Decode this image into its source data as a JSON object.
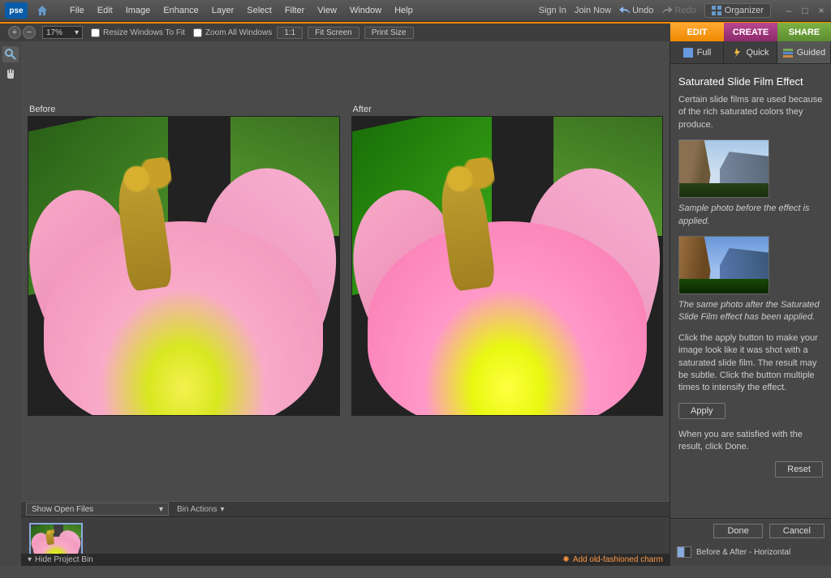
{
  "app_logo": "pse",
  "menu": [
    "File",
    "Edit",
    "Image",
    "Enhance",
    "Layer",
    "Select",
    "Filter",
    "View",
    "Window",
    "Help"
  ],
  "topbar": {
    "signin": "Sign In",
    "joinnow": "Join Now",
    "undo": "Undo",
    "redo": "Redo",
    "organizer": "Organizer"
  },
  "options": {
    "zoom_percent": "17%",
    "resize_windows": "Resize Windows To Fit",
    "zoom_all": "Zoom All Windows",
    "one_to_one": "1:1",
    "fit_screen": "Fit Screen",
    "print_size": "Print Size"
  },
  "mode_tabs": {
    "edit": "EDIT",
    "create": "CREATE",
    "share": "SHARE"
  },
  "compare": {
    "before_label": "Before",
    "after_label": "After"
  },
  "bin": {
    "dropdown": "Show Open Files",
    "actions": "Bin Actions"
  },
  "subtabs": {
    "full": "Full",
    "quick": "Quick",
    "guided": "Guided"
  },
  "panel": {
    "title": "Saturated Slide Film Effect",
    "desc": "Certain slide films are used because of the rich saturated colors they produce.",
    "caption_before": "Sample photo before the effect is applied.",
    "caption_after": "The same photo after the Saturated Slide Film effect has been applied.",
    "instr": "Click the apply button to make your image look like it was shot with a saturated slide film. The result may be subtle. Click the button multiple times to intensify the effect.",
    "apply": "Apply",
    "instr2": "When you are satisfied with the result, click Done.",
    "reset": "Reset",
    "done": "Done",
    "cancel": "Cancel",
    "viewmode": "Before & After - Horizontal"
  },
  "status": {
    "hide_bin": "Hide Project Bin",
    "charm": "Add old-fashioned charm"
  }
}
